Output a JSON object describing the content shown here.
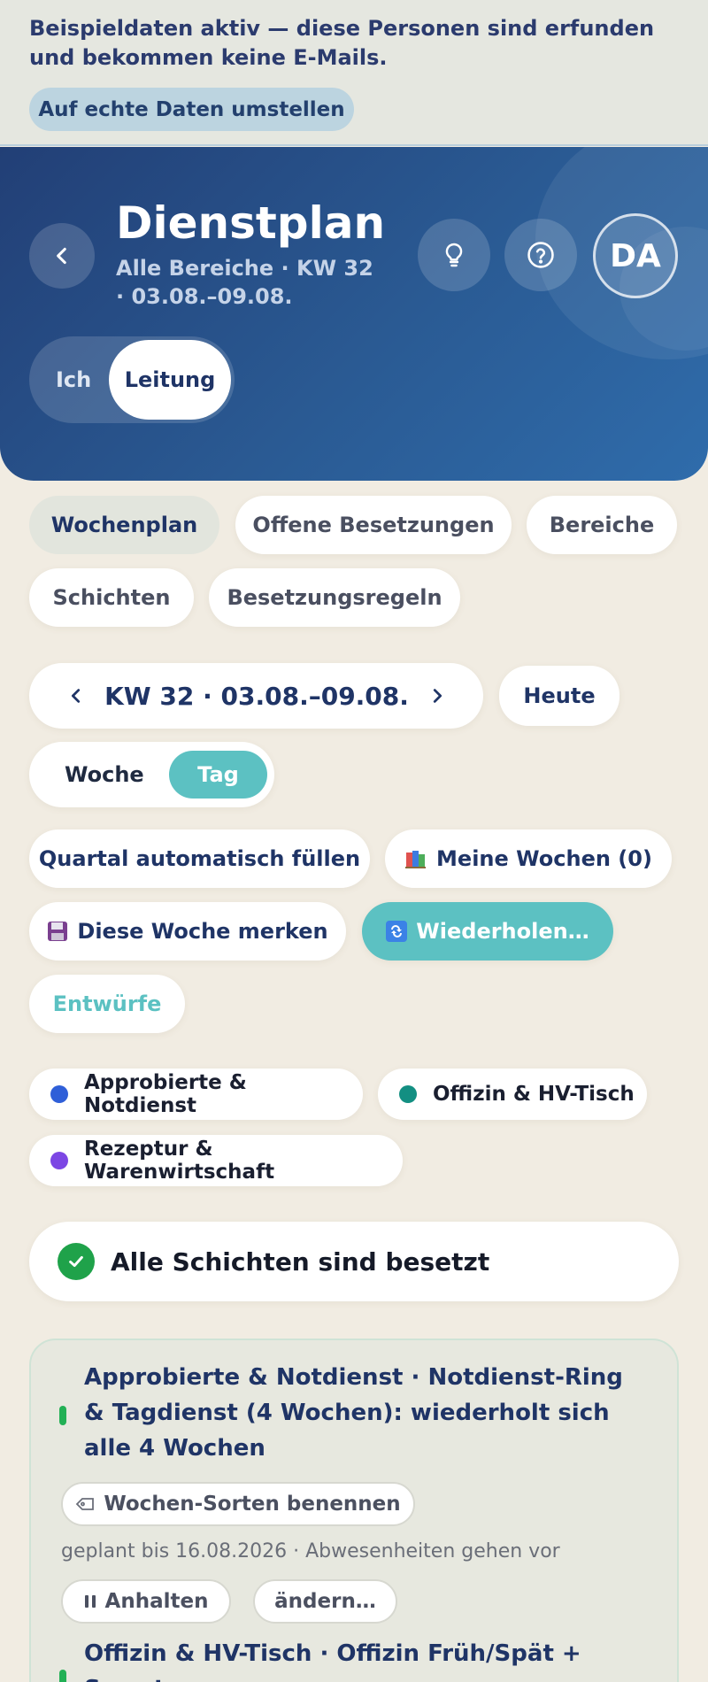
{
  "demo_banner": {
    "text": "Beispieldaten aktiv — diese Personen sind erfunden und bekommen keine E-Mails.",
    "switch_button": "Auf echte Daten umstellen"
  },
  "header": {
    "title": "Dienstplan",
    "subtitle": "Alle Bereiche · KW 32 · 03.08.–09.08.",
    "avatar_initials": "DA",
    "role_toggle": {
      "me": "Ich",
      "lead": "Leitung",
      "selected": "Leitung"
    }
  },
  "tabs": [
    {
      "label": "Wochenplan",
      "active": true
    },
    {
      "label": "Offene Besetzungen",
      "active": false
    },
    {
      "label": "Bereiche",
      "active": false
    },
    {
      "label": "Schichten",
      "active": false
    },
    {
      "label": "Besetzungsregeln",
      "active": false
    }
  ],
  "week_nav": {
    "label": "KW 32 · 03.08.–09.08.",
    "today_button": "Heute"
  },
  "view_toggle": {
    "week": "Woche",
    "day": "Tag",
    "selected": "Tag"
  },
  "actions": {
    "fill_quarter": "Quartal automatisch füllen",
    "my_weeks": "Meine Wochen (0)",
    "save_week": "Diese Woche merken",
    "repeat": "Wiederholen…",
    "drafts": "Entwürfe"
  },
  "legend": [
    {
      "label": "Approbierte & Notdienst",
      "color": "#2f5fd8"
    },
    {
      "label": "Offizin & HV-Tisch",
      "color": "#138f82"
    },
    {
      "label": "Rezeptur & Warenwirtschaft",
      "color": "#7c46e4"
    }
  ],
  "status": {
    "text": "Alle Schichten sind besetzt"
  },
  "rotations": [
    {
      "title": "Approbierte & Notdienst · Notdienst-Ring & Tagdienst (4 Wochen): wiederholt sich alle 4 Wochen",
      "name_button": "Wochen-Sorten benennen",
      "meta": "geplant bis 16.08.2026 · Abwesenheiten gehen vor",
      "pause_button": "Anhalten",
      "edit_button": "ändern…"
    },
    {
      "title": "Offizin & HV-Tisch · Offizin Früh/Spät + Samstag"
    }
  ],
  "colors": {
    "header_start": "#223f76",
    "header_end": "#2f6cab",
    "accent_teal": "#5cc1c2",
    "success_green": "#1fa24a",
    "background": "#f1ece2"
  }
}
